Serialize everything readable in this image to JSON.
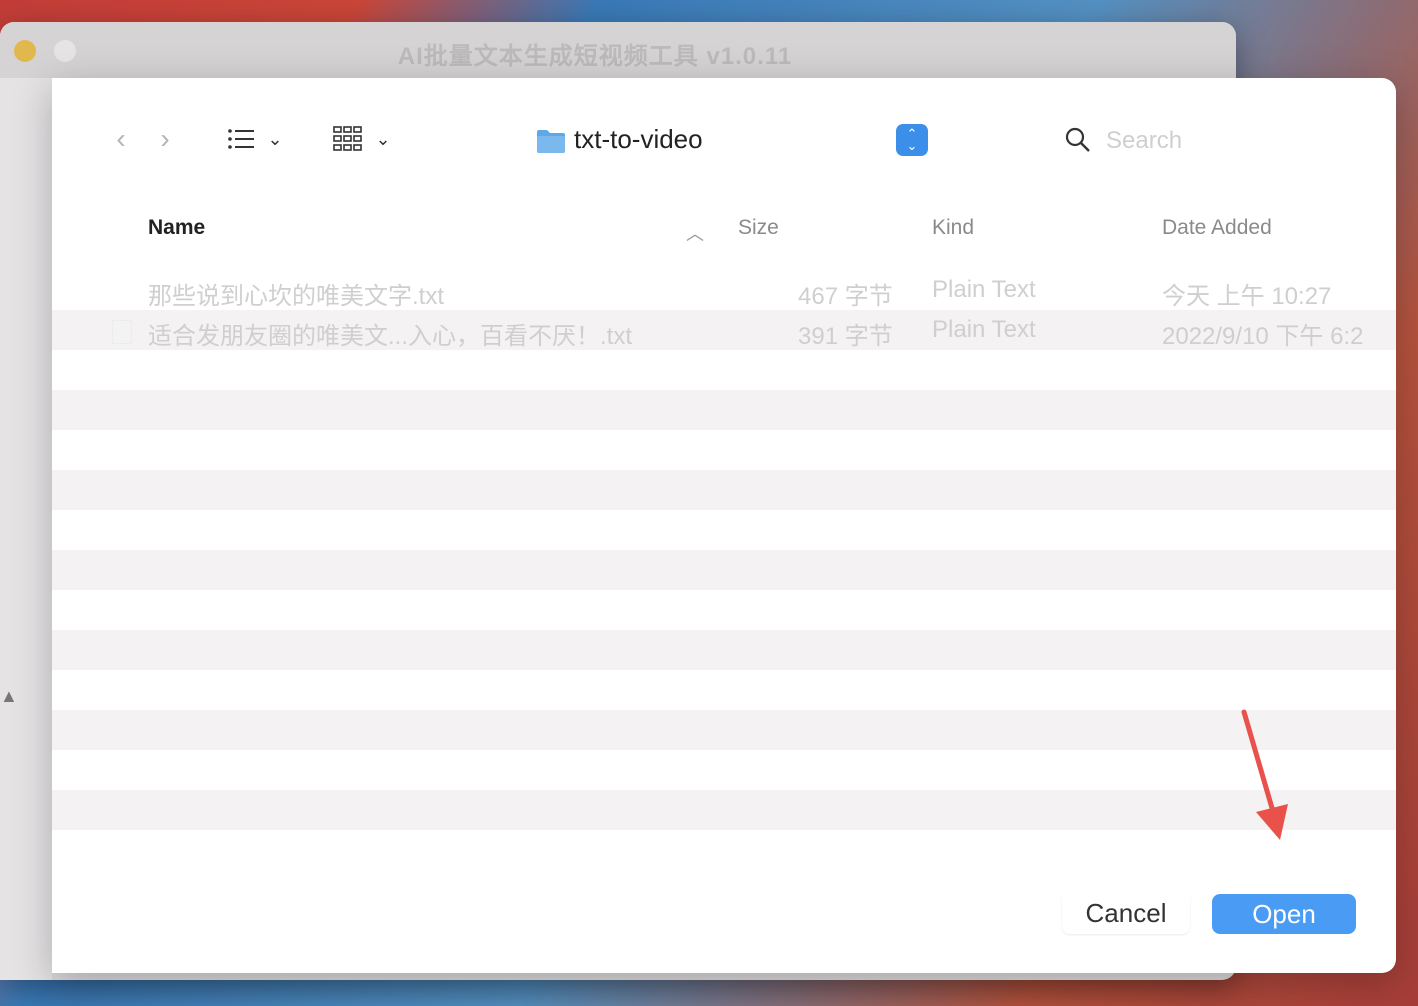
{
  "app": {
    "title": "AI批量文本生成短视频工具 v1.0.11"
  },
  "dialog": {
    "location": "txt-to-video",
    "search": {
      "placeholder": "Search",
      "value": ""
    },
    "columns": {
      "name": "Name",
      "size": "Size",
      "kind": "Kind",
      "date_added": "Date Added"
    },
    "files": [
      {
        "name": "那些说到心坎的唯美文字.txt",
        "size": "467 字节",
        "kind": "Plain Text",
        "date_added": "今天 上午 10:27"
      },
      {
        "name": "适合发朋友圈的唯美文...入心，百看不厌！.txt",
        "size": "391 字节",
        "kind": "Plain Text",
        "date_added": "2022/9/10 下午 6:2"
      }
    ],
    "buttons": {
      "cancel": "Cancel",
      "open": "Open"
    }
  },
  "colors": {
    "accent": "#4a9bf4",
    "annotation_arrow": "#e8524a"
  }
}
